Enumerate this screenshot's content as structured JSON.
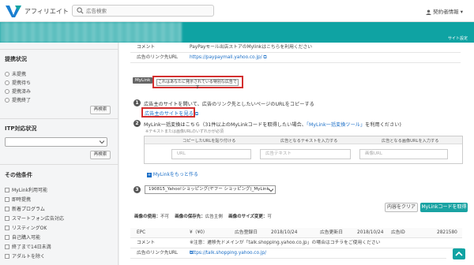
{
  "header": {
    "brand": "アフィリエイト",
    "search_placeholder": "広告検索",
    "user_label": "契約者情報"
  },
  "banner": {
    "site_settings": "サイト設定"
  },
  "sidebar": {
    "listing_status": {
      "title": "提携状況",
      "options": [
        "未提携",
        "提携待ち",
        "提携済み",
        "提携終了"
      ],
      "search_btn": "再検索"
    },
    "itp": {
      "title": "ITP対応状況",
      "search_btn": "再検索"
    },
    "other": {
      "title": "その他条件",
      "options": [
        "MyLink利用可能",
        "即時提携",
        "新着プログラム",
        "スマートフォン広告対応",
        "リスティングOK",
        "自己購入可能",
        "終了まで14日未満",
        "アダルトを除く"
      ]
    }
  },
  "ad_info_top": {
    "comment_label": "コメント",
    "comment_value": "PayPayモール出店ストアのMylinkはこちらを利用ください",
    "url_label": "広告のリンク先URL",
    "url_value": "https://paypaymall.yahoo.co.jp/"
  },
  "mylink": {
    "badge": "MyLink",
    "special_button": "これはあなたに発示されている特別な広告です",
    "step1_text": "広告主のサイトを開いて、広告のリンク先としたいページのURLをコピーする",
    "step1_link": "広告主のサイトを見る",
    "step2_text_prefix": "MyLink一括変換はこちら（31件以上のMyLinkコードを取得したい場合、",
    "step2_link": "「MyLink一括変換ツール」",
    "step2_text_suffix": "を利用ください)",
    "step2_note": "※テキストまたは画像URLのいずれかが必須",
    "columns": [
      "コピーしたURLを貼り付ける",
      "広告となるテキストを入力する",
      "広告となる画像URLを入力する"
    ],
    "placeholders": [
      "URL",
      "広告テキスト",
      "画像URL"
    ],
    "more": "MyLinkをもっと作る",
    "step3_value": "190815_Yahoo!ショッピング(ヤフー ショッピング)_MyLink",
    "numbers": [
      "1",
      "2",
      "3"
    ]
  },
  "image_meta": {
    "use_label": "画像の使用：",
    "use_value": "不可",
    "save_label": "画像の保存先：",
    "save_value": "広告主側",
    "size_label": "画像のサイズ変更：",
    "size_value": "可"
  },
  "buttons": {
    "clear": "内容をクリア",
    "get_code": "MyLinkコードを取得"
  },
  "ad_info_bottom": {
    "epc_label": "EPC",
    "epc_value": "¥（¥0）",
    "reg_label": "広告登録日",
    "reg_value": "2018/10/24",
    "upd_label": "広告更新日",
    "upd_value": "2018/10/24",
    "id_label": "広告ID",
    "id_value": "2821580",
    "comment_label": "コメント",
    "comment_value": "※注意：遷移先ドメインが「talk.shopping.yahoo.co.jp」の場合はコチラをご使用ください",
    "url_label": "広告のリンク先URL",
    "url_value": "https://talk.shopping.yahoo.co.jp/"
  },
  "accent": "#0fa3a3",
  "highlight": "#d32f2f"
}
